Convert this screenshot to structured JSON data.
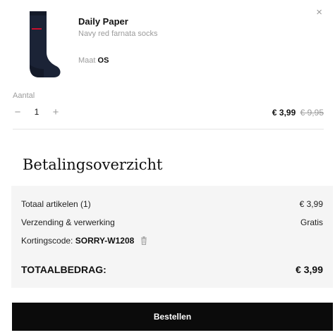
{
  "cart_item": {
    "brand": "Daily Paper",
    "product_name": "Navy red farnata socks",
    "size_label": "Maat",
    "size_value": "OS",
    "quantity_label": "Aantal",
    "quantity": "1",
    "decrement_symbol": "−",
    "increment_symbol": "+",
    "close_symbol": "×",
    "price_current": "€ 3,99",
    "price_original": "€ 9,95",
    "image_icon": "sock-product-image"
  },
  "summary": {
    "title": "Betalingsoverzicht",
    "items_label": "Totaal artikelen (1)",
    "items_value": "€ 3,99",
    "shipping_label": "Verzending & verwerking",
    "shipping_value": "Gratis",
    "discount_label": "Kortingscode:",
    "discount_code": "SORRY-W1208",
    "total_label": "TOTAALBEDRAG:",
    "total_value": "€ 3,99"
  },
  "checkout": {
    "order_label": "Bestellen"
  },
  "colors": {
    "button_bg": "#0b0b0b",
    "summary_bg": "#f5f5f5",
    "sock_navy": "#1b2336",
    "sock_accent": "#c8102e"
  }
}
